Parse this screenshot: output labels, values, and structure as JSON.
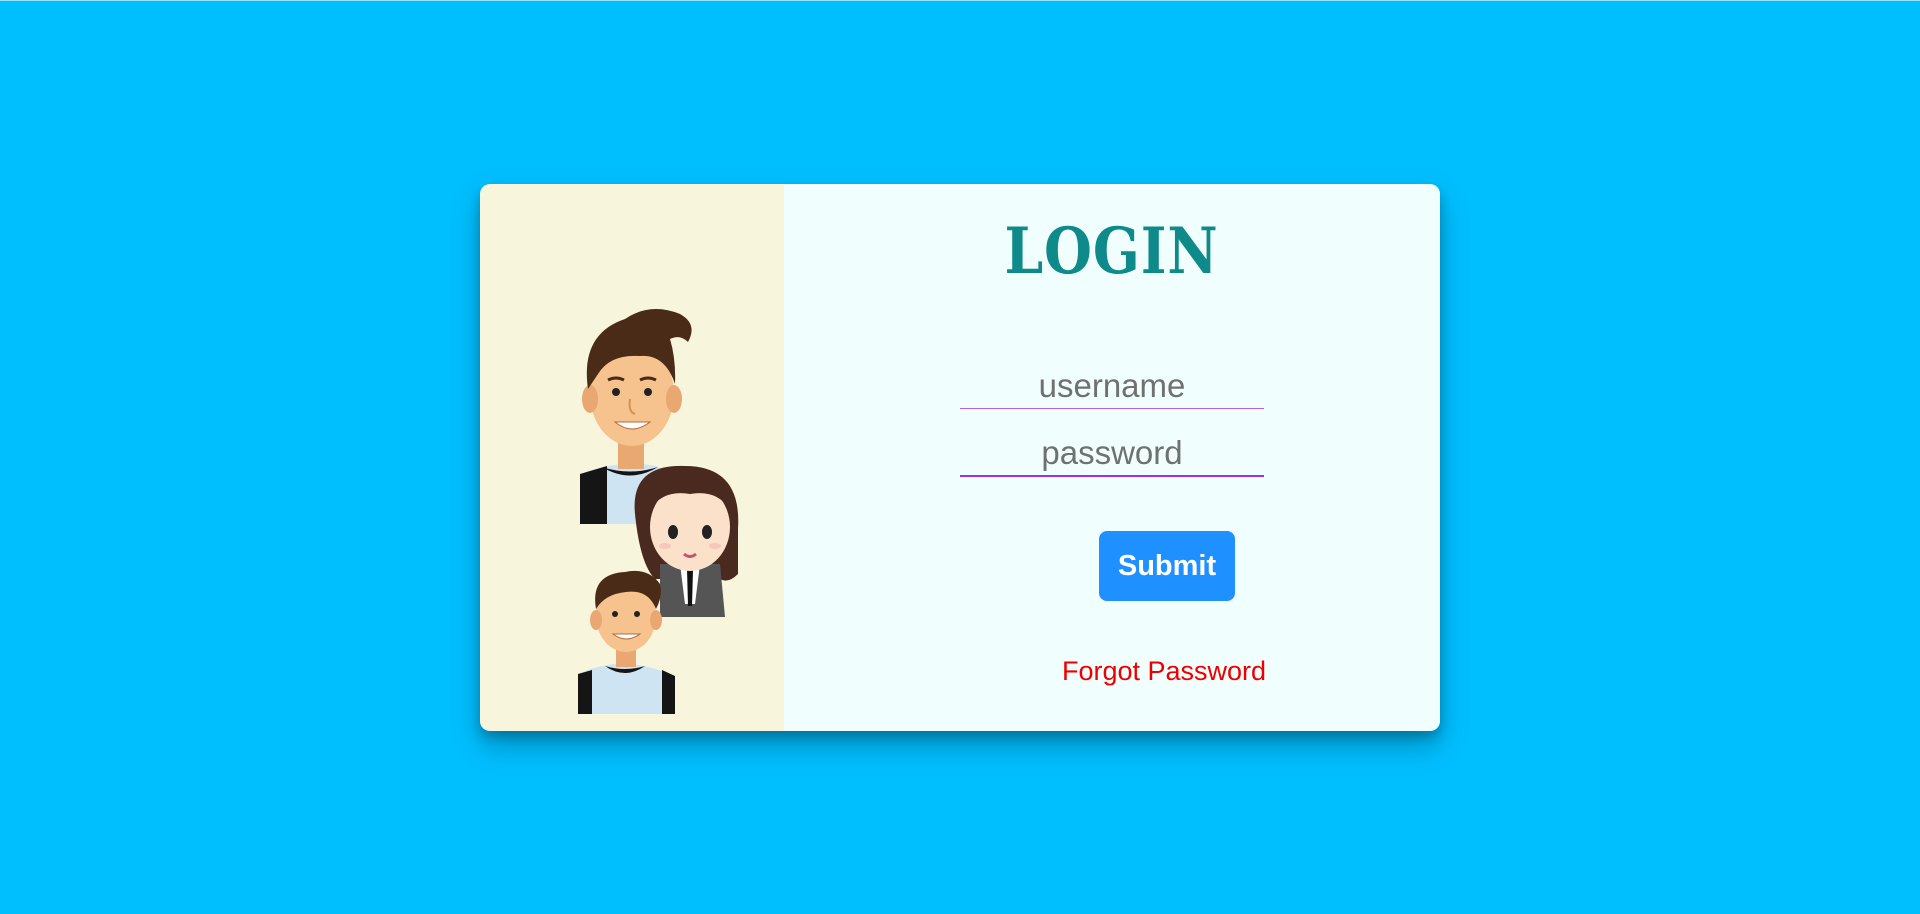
{
  "login": {
    "title": "LOGIN",
    "username_placeholder": "username",
    "password_placeholder": "password",
    "submit_label": "Submit",
    "forgot_label": "Forgot Password"
  },
  "illustration": {
    "subject": "three-people-avatars-icon"
  },
  "colors": {
    "page_background": "#00bfff",
    "art_panel_background": "#f7f5dc",
    "form_panel_background": "#f0fffe",
    "title": "#0f8a8a",
    "submit_button": "#1e90ff",
    "forgot_link": "#ee0000",
    "input_underline": "#9b2ff5"
  }
}
